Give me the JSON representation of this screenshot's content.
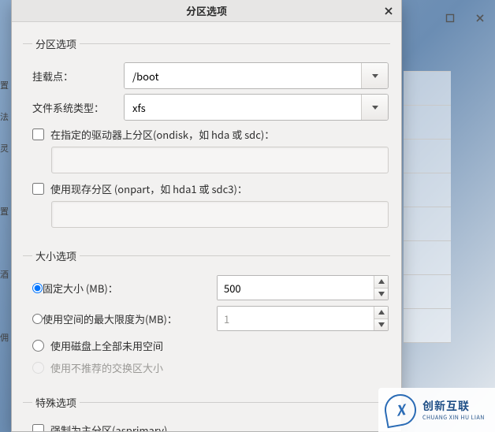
{
  "dialog": {
    "title": "分区选项"
  },
  "partition": {
    "legend": "分区选项",
    "mount_label": "挂载点：",
    "mount_value": "/boot",
    "fs_label": "文件系统类型：",
    "fs_value": "xfs",
    "ondisk_label": "在指定的驱动器上分区(ondisk，如 hda 或 sdc)：",
    "onpart_label": "使用现存分区 (onpart，如 hda1 或 sdc3)："
  },
  "size": {
    "legend": "大小选项",
    "fixed_label": "固定大小 (MB)：",
    "fixed_value": "500",
    "max_label": "使用空间的最大限度为(MB)：",
    "max_value": "1",
    "fill_label": "使用磁盘上全部未用空间",
    "swap_label": "使用不推荐的交换区大小"
  },
  "special": {
    "legend": "特殊选项",
    "asprimary_label": "强制为主分区(asprimary)"
  },
  "watermark": {
    "cn": "创新互联",
    "en": "CHUANG XIN HU LIAN"
  }
}
